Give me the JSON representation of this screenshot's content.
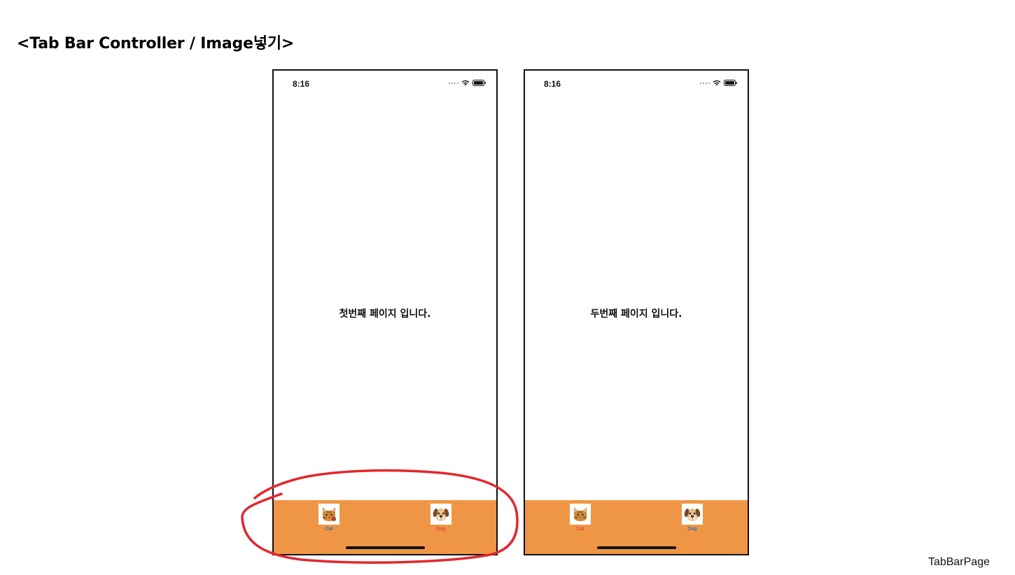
{
  "slide": {
    "title": "<Tab Bar Controller / Image넣기>",
    "footer": "TabBarPage"
  },
  "phones": [
    {
      "status_time": "8:16",
      "page_text": "첫번째 페이지 입니다.",
      "tabs": [
        {
          "label": "Cat",
          "icon": "cat-icon",
          "color": "#3b6fb0",
          "selected": false
        },
        {
          "label": "Dog",
          "icon": "dog-icon",
          "color": "#e8463a",
          "selected": true
        }
      ]
    },
    {
      "status_time": "8:16",
      "page_text": "두번째 페이지 입니다.",
      "tabs": [
        {
          "label": "Cat",
          "icon": "cat-icon",
          "color": "#e8463a",
          "selected": true
        },
        {
          "label": "Dog",
          "icon": "dog-icon",
          "color": "#3b6fb0",
          "selected": false
        }
      ]
    }
  ],
  "colors": {
    "tab_bar": "#ef9646",
    "annotation": "#e0282e",
    "selected_tab": "#e8463a",
    "unselected_tab": "#3b6fb0"
  }
}
